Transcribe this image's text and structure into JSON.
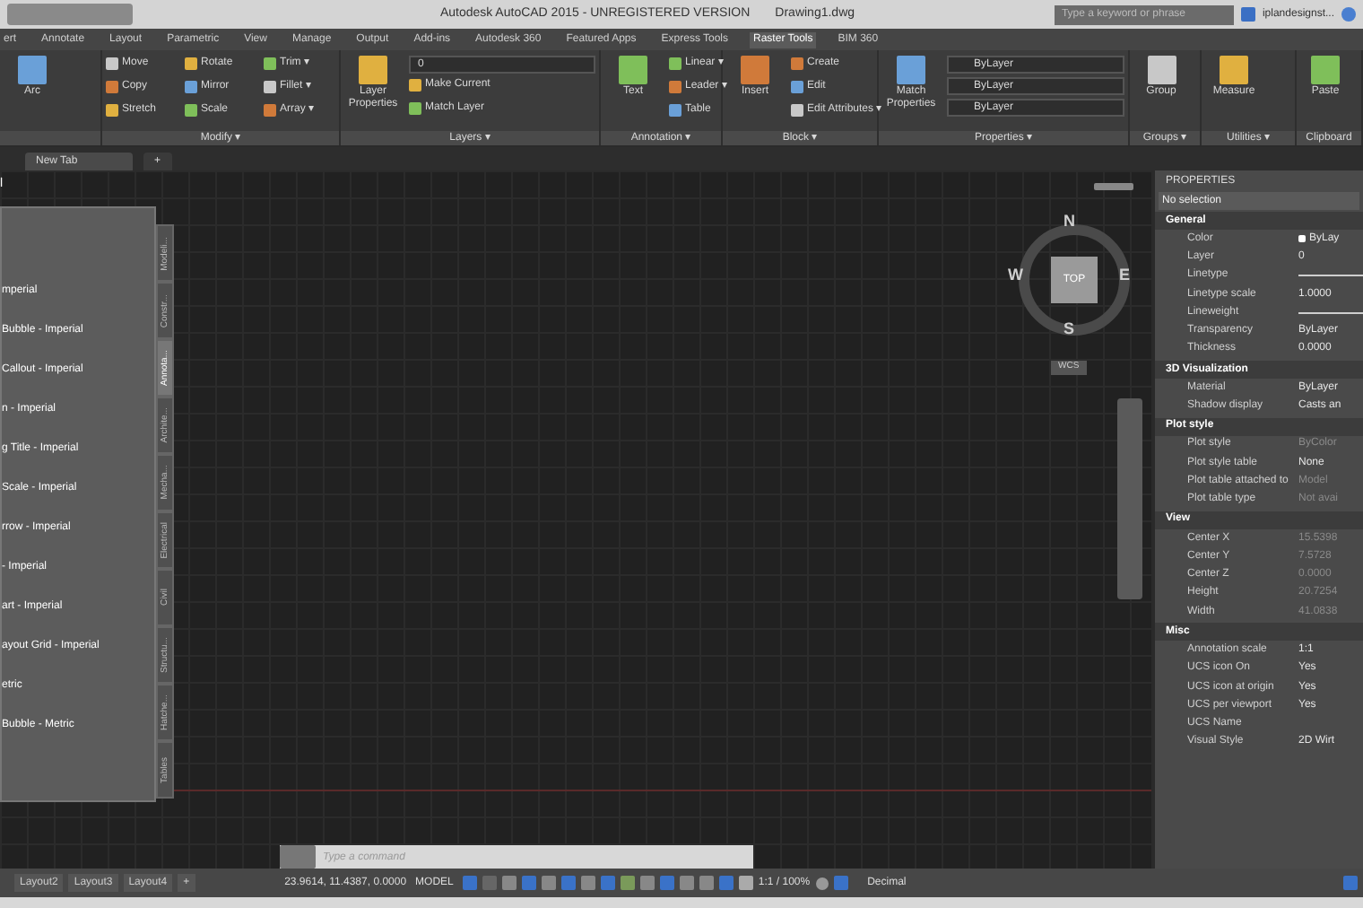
{
  "window": {
    "title": "Autodesk AutoCAD 2015 - UNREGISTERED VERSION",
    "document": "Drawing1.dwg"
  },
  "search": {
    "placeholder": "Type a keyword or phrase"
  },
  "user": {
    "name": "iplandesignst..."
  },
  "ribbon_tabs": [
    {
      "label": "ert",
      "selected": false
    },
    {
      "label": "Annotate",
      "selected": false
    },
    {
      "label": "Layout",
      "selected": false
    },
    {
      "label": "Parametric",
      "selected": false
    },
    {
      "label": "View",
      "selected": false
    },
    {
      "label": "Manage",
      "selected": false
    },
    {
      "label": "Output",
      "selected": false
    },
    {
      "label": "Add-ins",
      "selected": false
    },
    {
      "label": "Autodesk 360",
      "selected": false
    },
    {
      "label": "Featured Apps",
      "selected": false
    },
    {
      "label": "Express Tools",
      "selected": false
    },
    {
      "label": "Raster Tools",
      "selected": true
    },
    {
      "label": "BIM 360",
      "selected": false
    }
  ],
  "panels": [
    {
      "large": "Arc"
    },
    {
      "label": "Modify ▾",
      "small": [
        "Move",
        "Rotate",
        "Trim ▾",
        "Copy",
        "Mirror",
        "Fillet ▾",
        "Stretch",
        "Scale",
        "Array ▾"
      ]
    },
    {
      "label": "Layers ▾",
      "large": "Layer Properties",
      "dropdown": "0",
      "small": [
        "Make Current",
        "Match Layer"
      ]
    },
    {
      "label": "Annotation ▾",
      "large": "Text",
      "small": [
        "Linear ▾",
        "Leader ▾",
        "Table"
      ]
    },
    {
      "label": "Block ▾",
      "large": "Insert",
      "small": [
        "Create",
        "Edit",
        "Edit Attributes ▾"
      ]
    },
    {
      "label": "Properties ▾",
      "large": "Match Properties",
      "dropdowns": [
        "ByLayer",
        "ByLayer",
        "ByLayer"
      ]
    },
    {
      "label": "Groups ▾",
      "large": "Group"
    },
    {
      "label": "Utilities ▾",
      "large": "Measure"
    },
    {
      "label": "Clipboard",
      "large": "Paste"
    }
  ],
  "file_tabs": [
    {
      "label": "New Tab",
      "selected": true
    },
    {
      "label": "+",
      "selected": false
    }
  ],
  "palette": {
    "title": "l",
    "items": [
      "mperial",
      "Bubble - Imperial",
      "Callout - Imperial",
      "n - Imperial",
      "g Title - Imperial",
      "Scale - Imperial",
      "rrow - Imperial",
      "- Imperial",
      "art - Imperial",
      "ayout Grid - Imperial",
      "etric",
      "Bubble - Metric"
    ],
    "tabs": [
      {
        "label": "Modeli...",
        "selected": false
      },
      {
        "label": "Constr...",
        "selected": false
      },
      {
        "label": "Annota...",
        "selected": true
      },
      {
        "label": "Archite...",
        "selected": false
      },
      {
        "label": "Mecha...",
        "selected": false
      },
      {
        "label": "Electrical",
        "selected": false
      },
      {
        "label": "Civil",
        "selected": false
      },
      {
        "label": "Structu...",
        "selected": false
      },
      {
        "label": "Hatche...",
        "selected": false
      },
      {
        "label": "Tables",
        "selected": false
      }
    ]
  },
  "viewcube": {
    "north": "N",
    "south": "S",
    "east": "E",
    "west": "W",
    "face": "TOP",
    "ucs": "WCS"
  },
  "properties": {
    "title": "PROPERTIES",
    "selection": "No selection",
    "sections": [
      {
        "name": "General",
        "rows": [
          {
            "label": "Color",
            "value": "ByLay",
            "kind": "color",
            "disabled": false
          },
          {
            "label": "Layer",
            "value": "0",
            "kind": "text",
            "disabled": false
          },
          {
            "label": "Linetype",
            "kind": "line",
            "disabled": false
          },
          {
            "label": "Linetype scale",
            "value": "1.0000",
            "kind": "text",
            "disabled": false
          },
          {
            "label": "Lineweight",
            "kind": "line",
            "disabled": false
          },
          {
            "label": "Transparency",
            "value": "ByLayer",
            "kind": "text",
            "disabled": false
          },
          {
            "label": "Thickness",
            "value": "0.0000",
            "kind": "text",
            "disabled": false
          }
        ]
      },
      {
        "name": "3D Visualization",
        "rows": [
          {
            "label": "Material",
            "value": "ByLayer",
            "kind": "text",
            "disabled": false
          },
          {
            "label": "Shadow display",
            "value": "Casts an",
            "kind": "text",
            "disabled": false
          }
        ]
      },
      {
        "name": "Plot style",
        "rows": [
          {
            "label": "Plot style",
            "value": "ByColor",
            "kind": "text",
            "disabled": true
          },
          {
            "label": "Plot style table",
            "value": "None",
            "kind": "text",
            "disabled": false
          },
          {
            "label": "Plot table attached to",
            "value": "Model",
            "kind": "text",
            "disabled": true
          },
          {
            "label": "Plot table type",
            "value": "Not avai",
            "kind": "text",
            "disabled": true
          }
        ]
      },
      {
        "name": "View",
        "rows": [
          {
            "label": "Center X",
            "value": "15.5398",
            "kind": "text",
            "disabled": true
          },
          {
            "label": "Center Y",
            "value": "7.5728",
            "kind": "text",
            "disabled": true
          },
          {
            "label": "Center Z",
            "value": "0.0000",
            "kind": "text",
            "disabled": true
          },
          {
            "label": "Height",
            "value": "20.7254",
            "kind": "text",
            "disabled": true
          },
          {
            "label": "Width",
            "value": "41.0838",
            "kind": "text",
            "disabled": true
          }
        ]
      },
      {
        "name": "Misc",
        "rows": [
          {
            "label": "Annotation scale",
            "value": "1:1",
            "kind": "text",
            "disabled": false
          },
          {
            "label": "UCS icon On",
            "value": "Yes",
            "kind": "text",
            "disabled": false
          },
          {
            "label": "UCS icon at origin",
            "value": "Yes",
            "kind": "text",
            "disabled": false
          },
          {
            "label": "UCS per viewport",
            "value": "Yes",
            "kind": "text",
            "disabled": false
          },
          {
            "label": "UCS Name",
            "kind": "text",
            "disabled": false
          },
          {
            "label": "Visual Style",
            "value": "2D Wirt",
            "kind": "text",
            "disabled": false
          }
        ]
      }
    ]
  },
  "command_line": {
    "placeholder": "Type a command"
  },
  "status_bar": {
    "layout_tabs": [
      {
        "label": "Layout2",
        "selected": false
      },
      {
        "label": "Layout3",
        "selected": false
      },
      {
        "label": "Layout4",
        "selected": false
      },
      {
        "label": "+",
        "selected": false
      }
    ],
    "coordinates": "23.9614, 11.4387, 0.0000",
    "space": "MODEL",
    "scale": "1:1 / 100%",
    "units": "Decimal"
  }
}
